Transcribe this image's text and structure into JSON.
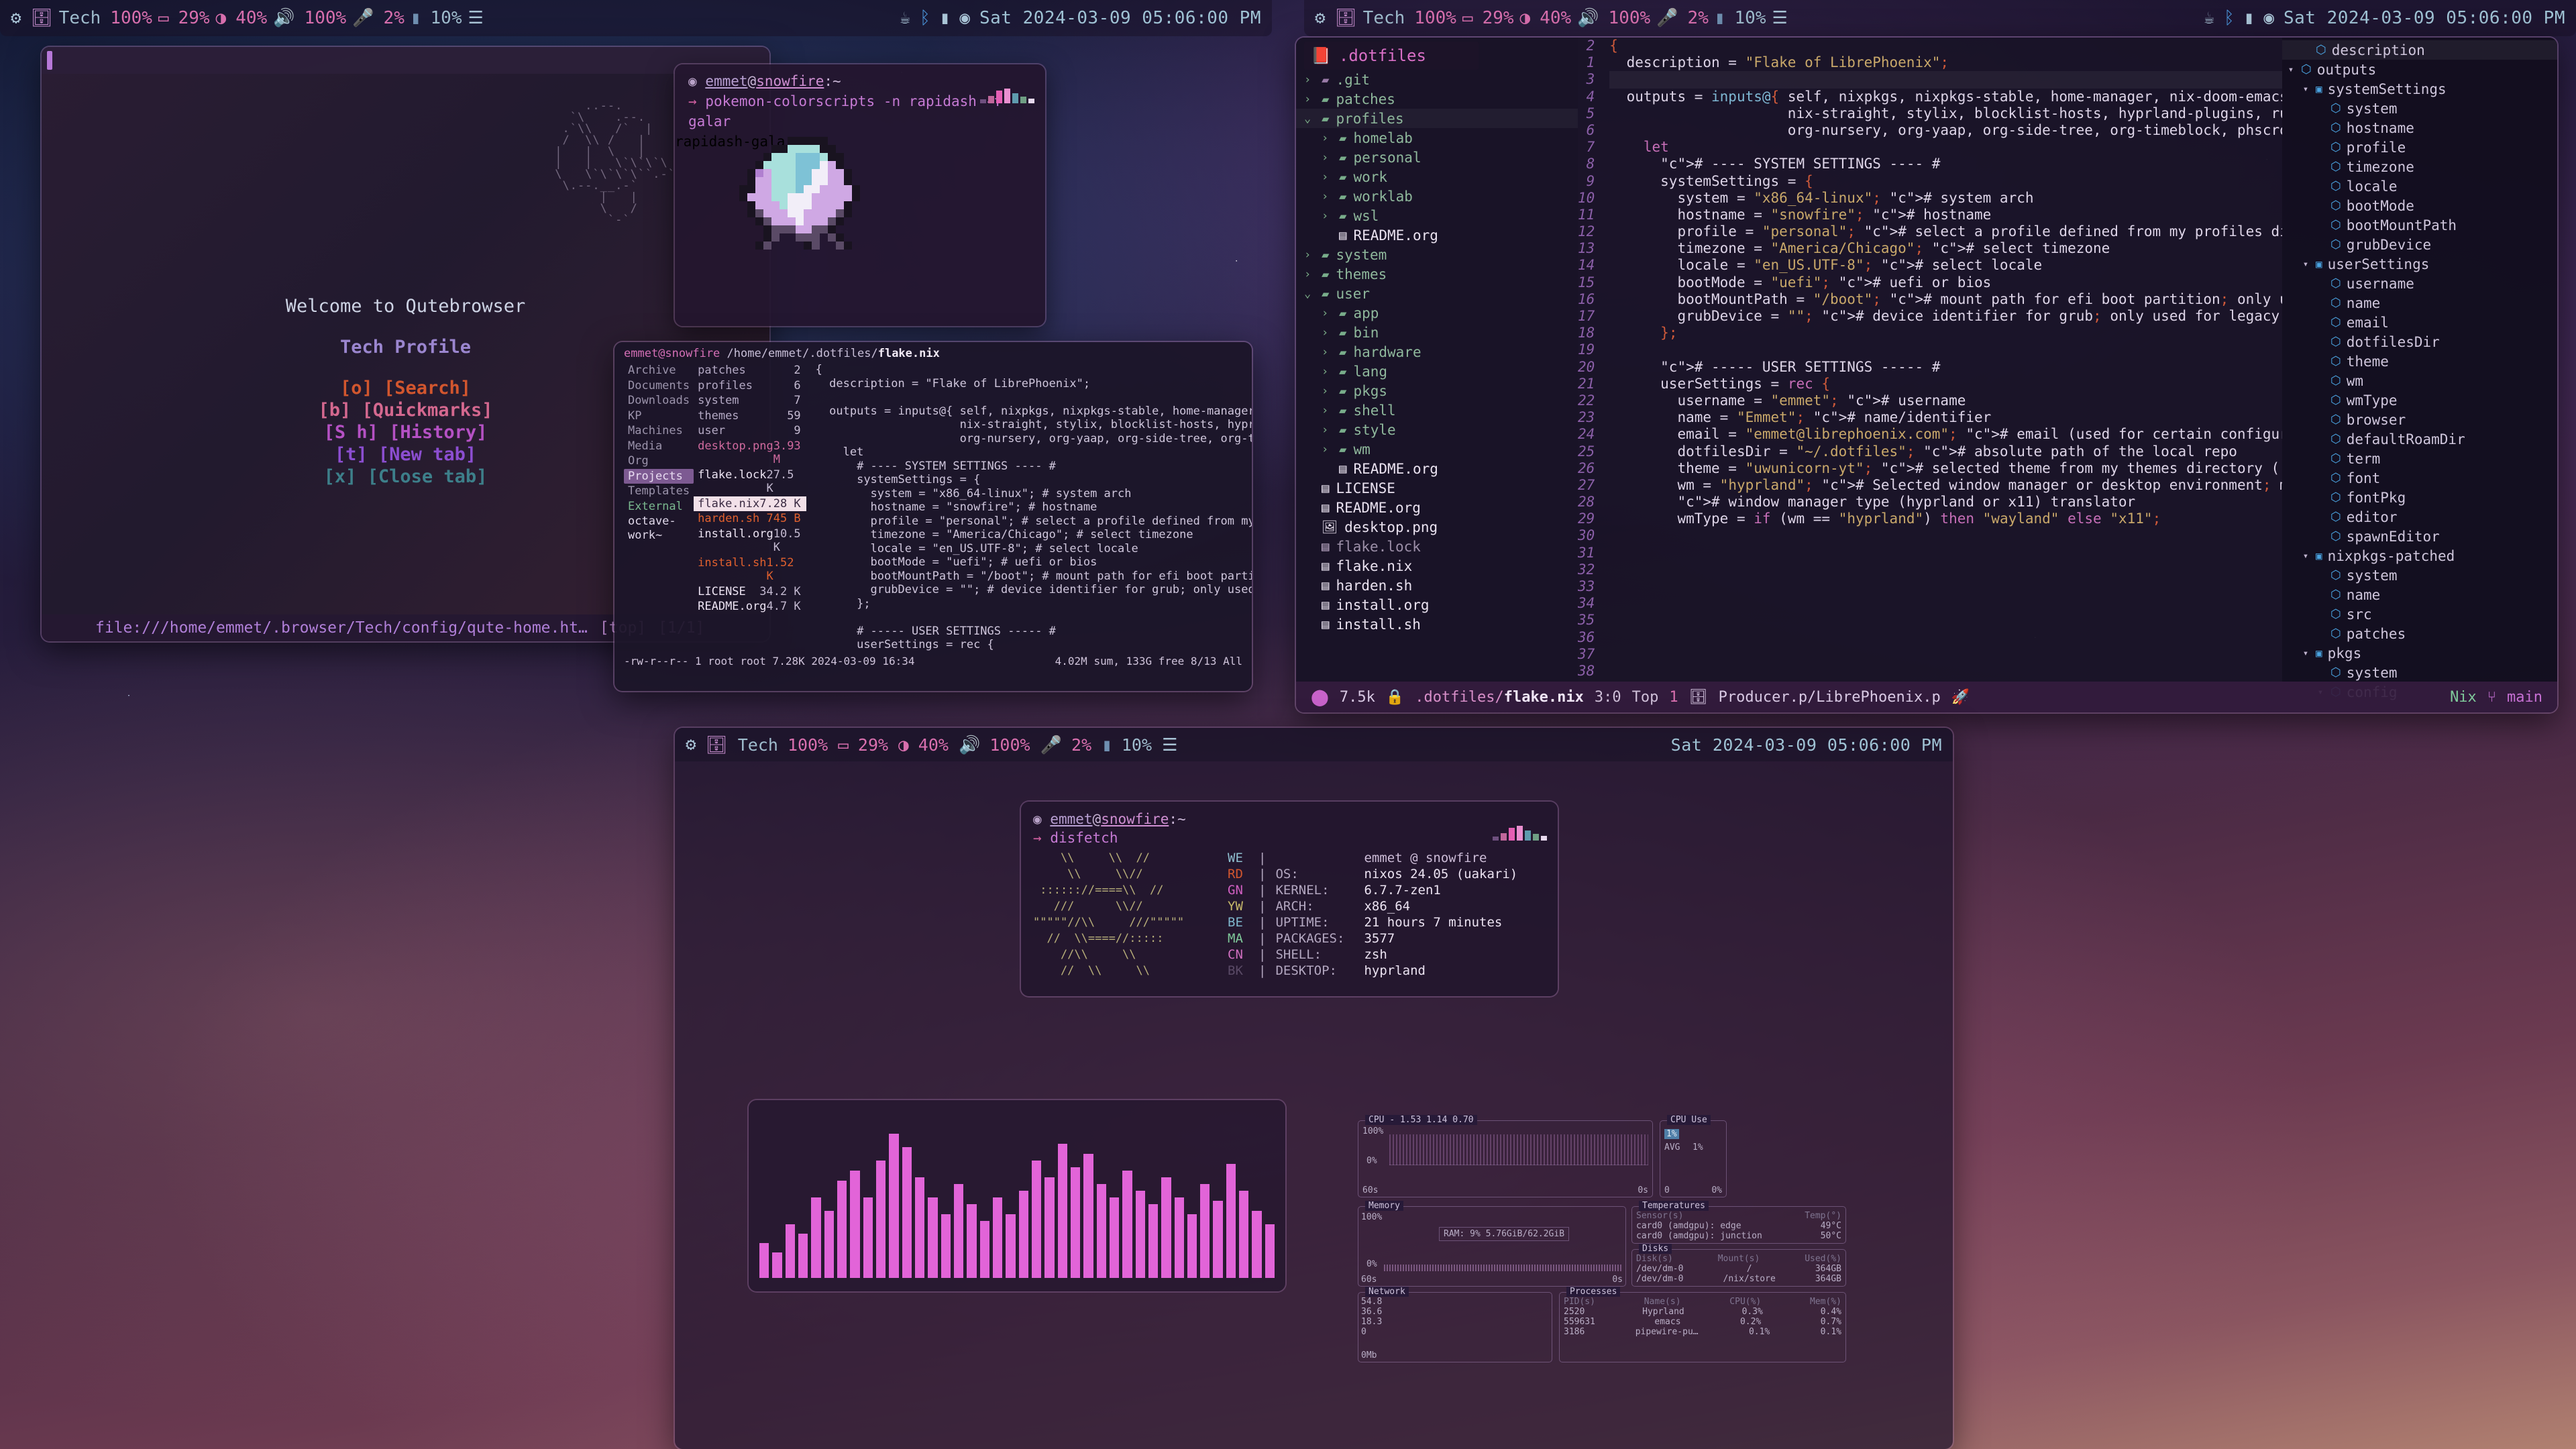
{
  "topbar": {
    "left": {
      "gear_icon": "gear-icon",
      "workspace_icon": "layers-icon",
      "workspace": "Tech",
      "brightness": "100%",
      "brightness_icon": "display-icon",
      "battery": "29%",
      "battery_icon": "battery-icon",
      "volume": "40%",
      "volume_icon": "speaker-icon",
      "mic": "100%",
      "mic_icon": "microphone-icon",
      "cpu": "2%",
      "cpu_icon": "chip-icon",
      "mem": "10%",
      "mem_icon": "memory-icon",
      "tray": [
        "no-coffee-icon",
        "bluetooth-icon",
        "wifi-icon",
        "disc-icon"
      ],
      "clock": "Sat 2024-03-09 05:06:00 PM"
    },
    "right": {
      "gear_icon": "gear-icon",
      "workspace_icon": "layers-icon",
      "workspace": "Tech",
      "brightness": "100%",
      "battery": "29%",
      "volume": "40%",
      "mic": "100%",
      "cpu": "2%",
      "mem": "10%",
      "clock": "Sat 2024-03-09 05:06:00 PM"
    },
    "bottom": {
      "workspace": "Tech",
      "brightness": "100%",
      "battery": "29%",
      "volume": "40%",
      "mic": "100%",
      "cpu": "2%",
      "mem": "10%",
      "clock": "Sat 2024-03-09 05:06:00 PM"
    }
  },
  "qutebrowser": {
    "welcome": "Welcome to Qutebrowser",
    "profile": "Tech Profile",
    "links": [
      {
        "key": "[o]",
        "label": "[Search]",
        "color": "#d2562e"
      },
      {
        "key": "[b]",
        "label": "[Quickmarks]",
        "color": "#d4688f"
      },
      {
        "key": "[S h]",
        "label": "[History]",
        "color": "#b551c4"
      },
      {
        "key": "[t]",
        "label": "[New tab]",
        "color": "#8c4ed1"
      },
      {
        "key": "[x]",
        "label": "[Close tab]",
        "color": "#3d7f8a"
      }
    ],
    "status_url": "file:///home/emmet/.browser/Tech/config/qute-home.ht…",
    "status_scroll": "[top]",
    "status_tab": "[1/1]"
  },
  "pokemon_terminal": {
    "prompt_user": "emmet",
    "prompt_at": "@",
    "prompt_host": "snowfire",
    "prompt_path": ":~",
    "arrow": "→",
    "command": "pokemon-colorscripts -n rapidash -f galar",
    "output": "rapidash-galar"
  },
  "filemanager": {
    "path_user": "emmet@snowfire",
    "path_dir": "/home/emmet/.dotfiles/",
    "path_file": "flake.nix",
    "parent_column": [
      {
        "name": "Archive",
        "kind": "dir"
      },
      {
        "name": "Documents",
        "kind": "dir"
      },
      {
        "name": "Downloads",
        "kind": "dir"
      },
      {
        "name": "KP",
        "kind": "dir"
      },
      {
        "name": "Machines",
        "kind": "dir"
      },
      {
        "name": "Media",
        "kind": "dir"
      },
      {
        "name": "Org",
        "kind": "dir"
      },
      {
        "name": "Projects",
        "kind": "dir",
        "selected": true
      },
      {
        "name": "Templates",
        "kind": "dir"
      },
      {
        "name": "External",
        "kind": "green"
      },
      {
        "name": "octave-work~",
        "kind": "white"
      }
    ],
    "current_column": [
      {
        "name": "patches",
        "size": "2",
        "kind": "dir"
      },
      {
        "name": "profiles",
        "size": "6",
        "kind": "dir"
      },
      {
        "name": "system",
        "size": "7",
        "kind": "dir"
      },
      {
        "name": "themes",
        "size": "59",
        "kind": "dir"
      },
      {
        "name": "user",
        "size": "9",
        "kind": "dir"
      },
      {
        "name": "desktop.png",
        "size": "3.93 M",
        "kind": "img"
      },
      {
        "name": "flake.lock",
        "size": "27.5 K",
        "kind": "file"
      },
      {
        "name": "flake.nix",
        "size": "7.28 K",
        "kind": "file",
        "selected": true
      },
      {
        "name": "harden.sh",
        "size": "745 B",
        "kind": "sh"
      },
      {
        "name": "install.org",
        "size": "10.5 K",
        "kind": "file"
      },
      {
        "name": "install.sh",
        "size": "1.52 K",
        "kind": "sh"
      },
      {
        "name": "LICENSE",
        "size": "34.2 K",
        "kind": "file"
      },
      {
        "name": "README.org",
        "size": "4.7 K",
        "kind": "file"
      }
    ],
    "status_left": "-rw-r--r-- 1 root root 7.28K 2024-03-09 16:34",
    "status_right": "4.02M sum, 133G free  8/13  All"
  },
  "emacs": {
    "tree_title": ".dotfiles",
    "tree_title_icon": "book-icon",
    "tree": [
      {
        "label": ".git",
        "type": "dir",
        "indent": 0,
        "chevron": "›",
        "icon": "folder-git-icon"
      },
      {
        "label": "patches",
        "type": "dir",
        "indent": 0,
        "chevron": "›",
        "icon": "folder-icon"
      },
      {
        "label": "profiles",
        "type": "dir",
        "indent": 0,
        "chevron": "⌄",
        "icon": "folder-open-icon",
        "highlight": true
      },
      {
        "label": "homelab",
        "type": "dir",
        "indent": 1,
        "chevron": "›",
        "icon": "folder-icon"
      },
      {
        "label": "personal",
        "type": "dir",
        "indent": 1,
        "chevron": "›",
        "icon": "folder-icon"
      },
      {
        "label": "work",
        "type": "dir",
        "indent": 1,
        "chevron": "›",
        "icon": "folder-icon"
      },
      {
        "label": "worklab",
        "type": "dir",
        "indent": 1,
        "chevron": "›",
        "icon": "folder-icon"
      },
      {
        "label": "wsl",
        "type": "dir",
        "indent": 1,
        "chevron": "›",
        "icon": "folder-icon"
      },
      {
        "label": "README.org",
        "type": "file",
        "indent": 1,
        "chevron": "",
        "icon": "document-icon"
      },
      {
        "label": "system",
        "type": "dir",
        "indent": 0,
        "chevron": "›",
        "icon": "folder-icon"
      },
      {
        "label": "themes",
        "type": "dir",
        "indent": 0,
        "chevron": "›",
        "icon": "folder-icon"
      },
      {
        "label": "user",
        "type": "dir",
        "indent": 0,
        "chevron": "⌄",
        "icon": "folder-open-icon"
      },
      {
        "label": "app",
        "type": "dir",
        "indent": 1,
        "chevron": "›",
        "icon": "folder-icon"
      },
      {
        "label": "bin",
        "type": "dir",
        "indent": 1,
        "chevron": "›",
        "icon": "folder-icon"
      },
      {
        "label": "hardware",
        "type": "dir",
        "indent": 1,
        "chevron": "›",
        "icon": "folder-icon"
      },
      {
        "label": "lang",
        "type": "dir",
        "indent": 1,
        "chevron": "›",
        "icon": "folder-icon"
      },
      {
        "label": "pkgs",
        "type": "dir",
        "indent": 1,
        "chevron": "›",
        "icon": "folder-icon"
      },
      {
        "label": "shell",
        "type": "dir",
        "indent": 1,
        "chevron": "›",
        "icon": "folder-icon"
      },
      {
        "label": "style",
        "type": "dir",
        "indent": 1,
        "chevron": "›",
        "icon": "folder-icon"
      },
      {
        "label": "wm",
        "type": "dir",
        "indent": 1,
        "chevron": "›",
        "icon": "folder-icon"
      },
      {
        "label": "README.org",
        "type": "file",
        "indent": 1,
        "chevron": "",
        "icon": "document-icon"
      },
      {
        "label": "LICENSE",
        "type": "file",
        "indent": 0,
        "chevron": "",
        "icon": "document-icon"
      },
      {
        "label": "README.org",
        "type": "file",
        "indent": 0,
        "chevron": "",
        "icon": "document-icon"
      },
      {
        "label": "desktop.png",
        "type": "img",
        "indent": 0,
        "chevron": "",
        "icon": "image-icon"
      },
      {
        "label": "flake.lock",
        "type": "dim",
        "indent": 0,
        "chevron": "",
        "icon": "binary-icon"
      },
      {
        "label": "flake.nix",
        "type": "file",
        "indent": 0,
        "chevron": "",
        "icon": "document-icon"
      },
      {
        "label": "harden.sh",
        "type": "file",
        "indent": 0,
        "chevron": "",
        "icon": "binary-icon"
      },
      {
        "label": "install.org",
        "type": "file",
        "indent": 0,
        "chevron": "",
        "icon": "document-icon"
      },
      {
        "label": "install.sh",
        "type": "file",
        "indent": 0,
        "chevron": "",
        "icon": "binary-icon"
      }
    ],
    "first_line_number": 2,
    "gutter_lines": [
      "2",
      "1",
      "3",
      "4",
      "5",
      "6",
      "7",
      "8",
      "9",
      "10",
      "11",
      "12",
      "13",
      "14",
      "15",
      "16",
      "17",
      "18",
      "19",
      "20",
      "21",
      "22",
      "23",
      "24",
      "25",
      "26",
      "27",
      "28",
      "29",
      "30",
      "31",
      "32",
      "33",
      "34",
      "35",
      "36",
      "37",
      "38"
    ],
    "code_lines": [
      "{",
      "  description = \"Flake of LibrePhoenix\";",
      "",
      "  outputs = inputs@{ self, nixpkgs, nixpkgs-stable, home-manager, nix-doom-emacs,",
      "                     nix-straight, stylix, blocklist-hosts, hyprland-plugins, rust-ov$",
      "                     org-nursery, org-yaap, org-side-tree, org-timeblock, phscroll, .$",
      "    let",
      "      # ---- SYSTEM SETTINGS ---- #",
      "      systemSettings = {",
      "        system = \"x86_64-linux\"; # system arch",
      "        hostname = \"snowfire\"; # hostname",
      "        profile = \"personal\"; # select a profile defined from my profiles directory",
      "        timezone = \"America/Chicago\"; # select timezone",
      "        locale = \"en_US.UTF-8\"; # select locale",
      "        bootMode = \"uefi\"; # uefi or bios",
      "        bootMountPath = \"/boot\"; # mount path for efi boot partition; only used for u$",
      "        grubDevice = \"\"; # device identifier for grub; only used for legacy (bios) bo$",
      "      };",
      "",
      "      # ----- USER SETTINGS ----- #",
      "      userSettings = rec {",
      "        username = \"emmet\"; # username",
      "        name = \"Emmet\"; # name/identifier",
      "        email = \"emmet@librephoenix.com\"; # email (used for certain configurations)",
      "        dotfilesDir = \"~/.dotfiles\"; # absolute path of the local repo",
      "        theme = \"uwunicorn-yt\"; # selected theme from my themes directory (./themes/)",
      "        wm = \"hyprland\"; # Selected window manager or desktop environment; must selec$",
      "        # window manager type (hyprland or x11) translator",
      "        wmType = if (wm == \"hyprland\") then \"wayland\" else \"x11\";"
    ],
    "outline": [
      {
        "label": "description",
        "indent": 1,
        "icon": "cube-icon",
        "tri": "",
        "highlight": true
      },
      {
        "label": "outputs",
        "indent": 0,
        "icon": "cube-icon",
        "tri": "▾"
      },
      {
        "label": "systemSettings",
        "indent": 1,
        "icon": "map-icon",
        "tri": "▾"
      },
      {
        "label": "system",
        "indent": 2,
        "icon": "cube-icon",
        "tri": ""
      },
      {
        "label": "hostname",
        "indent": 2,
        "icon": "cube-icon",
        "tri": ""
      },
      {
        "label": "profile",
        "indent": 2,
        "icon": "cube-icon",
        "tri": ""
      },
      {
        "label": "timezone",
        "indent": 2,
        "icon": "cube-icon",
        "tri": ""
      },
      {
        "label": "locale",
        "indent": 2,
        "icon": "cube-icon",
        "tri": ""
      },
      {
        "label": "bootMode",
        "indent": 2,
        "icon": "cube-icon",
        "tri": ""
      },
      {
        "label": "bootMountPath",
        "indent": 2,
        "icon": "cube-icon",
        "tri": ""
      },
      {
        "label": "grubDevice",
        "indent": 2,
        "icon": "cube-icon",
        "tri": ""
      },
      {
        "label": "userSettings",
        "indent": 1,
        "icon": "map-icon",
        "tri": "▾"
      },
      {
        "label": "username",
        "indent": 2,
        "icon": "cube-icon",
        "tri": ""
      },
      {
        "label": "name",
        "indent": 2,
        "icon": "cube-icon",
        "tri": ""
      },
      {
        "label": "email",
        "indent": 2,
        "icon": "cube-icon",
        "tri": ""
      },
      {
        "label": "dotfilesDir",
        "indent": 2,
        "icon": "cube-icon",
        "tri": ""
      },
      {
        "label": "theme",
        "indent": 2,
        "icon": "cube-icon",
        "tri": ""
      },
      {
        "label": "wm",
        "indent": 2,
        "icon": "cube-icon",
        "tri": ""
      },
      {
        "label": "wmType",
        "indent": 2,
        "icon": "cube-icon",
        "tri": ""
      },
      {
        "label": "browser",
        "indent": 2,
        "icon": "cube-icon",
        "tri": ""
      },
      {
        "label": "defaultRoamDir",
        "indent": 2,
        "icon": "cube-icon",
        "tri": ""
      },
      {
        "label": "term",
        "indent": 2,
        "icon": "cube-icon",
        "tri": ""
      },
      {
        "label": "font",
        "indent": 2,
        "icon": "cube-icon",
        "tri": ""
      },
      {
        "label": "fontPkg",
        "indent": 2,
        "icon": "cube-icon",
        "tri": ""
      },
      {
        "label": "editor",
        "indent": 2,
        "icon": "cube-icon",
        "tri": ""
      },
      {
        "label": "spawnEditor",
        "indent": 2,
        "icon": "cube-icon",
        "tri": ""
      },
      {
        "label": "nixpkgs-patched",
        "indent": 1,
        "icon": "map-icon",
        "tri": "▾"
      },
      {
        "label": "system",
        "indent": 2,
        "icon": "cube-icon",
        "tri": ""
      },
      {
        "label": "name",
        "indent": 2,
        "icon": "cube-icon",
        "tri": ""
      },
      {
        "label": "src",
        "indent": 2,
        "icon": "cube-icon",
        "tri": ""
      },
      {
        "label": "patches",
        "indent": 2,
        "icon": "cube-icon",
        "tri": ""
      },
      {
        "label": "pkgs",
        "indent": 1,
        "icon": "map-icon",
        "tri": "▾"
      },
      {
        "label": "system",
        "indent": 2,
        "icon": "cube-icon",
        "tri": ""
      },
      {
        "label": "config",
        "indent": 2,
        "icon": "cube-icon",
        "tri": "▾"
      }
    ],
    "modeline": {
      "size": "7.5k",
      "lock_icon": "lock-icon",
      "path": ".dotfiles/",
      "file": "flake.nix",
      "position": "3:0",
      "scroll": "Top",
      "workspace_num": "1",
      "workspace_icon": "layers-icon",
      "project": "Producer.p/LibrePhoenix.p",
      "rocket_icon": "rocket-icon",
      "major_mode": "Nix",
      "branch_icon": "branch-icon",
      "branch": "main"
    }
  },
  "disfetch": {
    "prompt_user": "emmet",
    "prompt_host": "snowfire",
    "prompt_path": ":~",
    "command": "disfetch",
    "art": [
      "    \\\\     \\\\  //",
      "     \\\\     \\\\//",
      " :::::://====\\\\  //",
      "   ///      \\\\//",
      "\"\"\"\"\"//\\\\     ///\"\"\"\"\"",
      "  //  \\\\====//:::::",
      "    //\\\\     \\\\",
      "    //  \\\\     \\\\"
    ],
    "tags": [
      "WE",
      "RD",
      "GN",
      "YW",
      "BE",
      "MA",
      "CN",
      "BK"
    ],
    "rows": [
      {
        "key": "",
        "value": "emmet @ snowfire",
        "header": true
      },
      {
        "key": "OS:",
        "value": "nixos 24.05 (uakari)"
      },
      {
        "key": "KERNEL:",
        "value": "6.7.7-zen1"
      },
      {
        "key": "ARCH:",
        "value": "x86_64"
      },
      {
        "key": "UPTIME:",
        "value": "21 hours 7 minutes"
      },
      {
        "key": "PACKAGES:",
        "value": "3577"
      },
      {
        "key": "SHELL:",
        "value": "zsh"
      },
      {
        "key": "DESKTOP:",
        "value": "hyprland"
      }
    ]
  },
  "monitor": {
    "cpu": {
      "title": "CPU",
      "header": "- 1.53 1.14 0.70",
      "axis_top": "100%",
      "axis_bottom": "0%",
      "time_left": "60s",
      "time_right": "0s",
      "use_title": "CPU Use",
      "use_value": "1%",
      "avg_label": "AVG",
      "avg_value": "1%",
      "bottom_left": "0",
      "bottom_right": "0%"
    },
    "memory": {
      "title": "Memory",
      "axis_top": "100%",
      "axis_bottom": "0%",
      "time_left": "60s",
      "time_right": "0s",
      "ram_label": "RAM:",
      "ram_pct": "9%",
      "ram_value": "5.76GiB/62.2GiB"
    },
    "temperatures": {
      "title": "Temperatures",
      "col_sensor": "Sensor(s)",
      "col_temp": "Temp(°)",
      "rows": [
        {
          "sensor": "card0 (amdgpu): edge",
          "temp": "49°C"
        },
        {
          "sensor": "card0 (amdgpu): junction",
          "temp": "50°C"
        }
      ]
    },
    "disks": {
      "title": "Disks",
      "col_disk": "Disk(s)",
      "col_mount": "Mount(s)",
      "col_used": "Used(%)",
      "rows": [
        {
          "disk": "/dev/dm-0",
          "mount": "/",
          "used": "364GB"
        },
        {
          "disk": "/dev/dm-0",
          "mount": "/nix/store",
          "used": "364GB"
        }
      ]
    },
    "network": {
      "title": "Network",
      "ticks": [
        "54.8",
        "36.6",
        "18.3",
        "0"
      ],
      "unit": "0Mb"
    },
    "processes": {
      "title": "Processes",
      "col_pid": "PID(s)",
      "col_name": "Name(s)",
      "col_cpu": "CPU(%)",
      "col_mem": "Mem(%)",
      "rows": [
        {
          "pid": "2520",
          "name": "Hyprland",
          "cpu": "0.3%",
          "mem": "0.4%"
        },
        {
          "pid": "559631",
          "name": "emacs",
          "cpu": "0.2%",
          "mem": "0.7%"
        },
        {
          "pid": "3186",
          "name": "pipewire-pu…",
          "cpu": "0.1%",
          "mem": "0.1%"
        }
      ]
    }
  }
}
